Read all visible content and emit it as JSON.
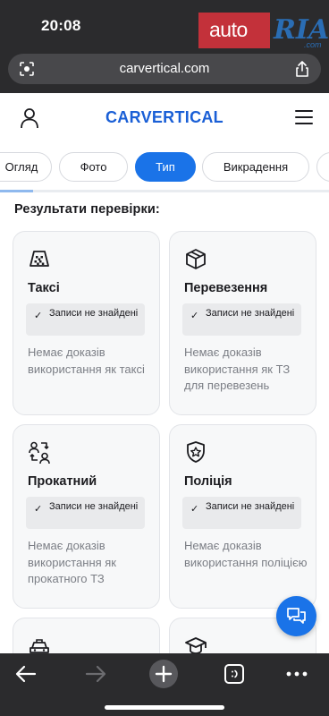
{
  "status_bar": {
    "time": "20:08"
  },
  "overlay_logo": {
    "part1": "auto",
    "part2": "RIA",
    "part3": ".com"
  },
  "browser": {
    "url": "carvertical.com"
  },
  "site": {
    "logo": "CARVERTICAL"
  },
  "tabs": [
    {
      "label": "Огляд",
      "active": false
    },
    {
      "label": "Фото",
      "active": false
    },
    {
      "label": "Тип",
      "active": true
    },
    {
      "label": "Викрадення",
      "active": false
    }
  ],
  "scroll_progress": 0.1,
  "section": {
    "title": "Результати перевірки:"
  },
  "cards": [
    {
      "icon": "taxi-icon",
      "title": "Таксі",
      "badge": "Записи не знайдені",
      "description": "Немає доказів використання як таксі"
    },
    {
      "icon": "cargo-box-icon",
      "title": "Перевезення",
      "badge": "Записи не знайдені",
      "description": "Немає доказів використання як ТЗ для перевезень"
    },
    {
      "icon": "rental-exchange-icon",
      "title": "Прокатний",
      "badge": "Записи не знайдені",
      "description": "Немає доказів використання як прокатного ТЗ"
    },
    {
      "icon": "police-badge-icon",
      "title": "Поліція",
      "badge": "Записи не знайдені",
      "description": "Немає доказів використання поліцією"
    }
  ],
  "colors": {
    "accent": "#1a73e8",
    "chrome": "#2b2b2d",
    "card_bg": "#f7f8f9"
  }
}
